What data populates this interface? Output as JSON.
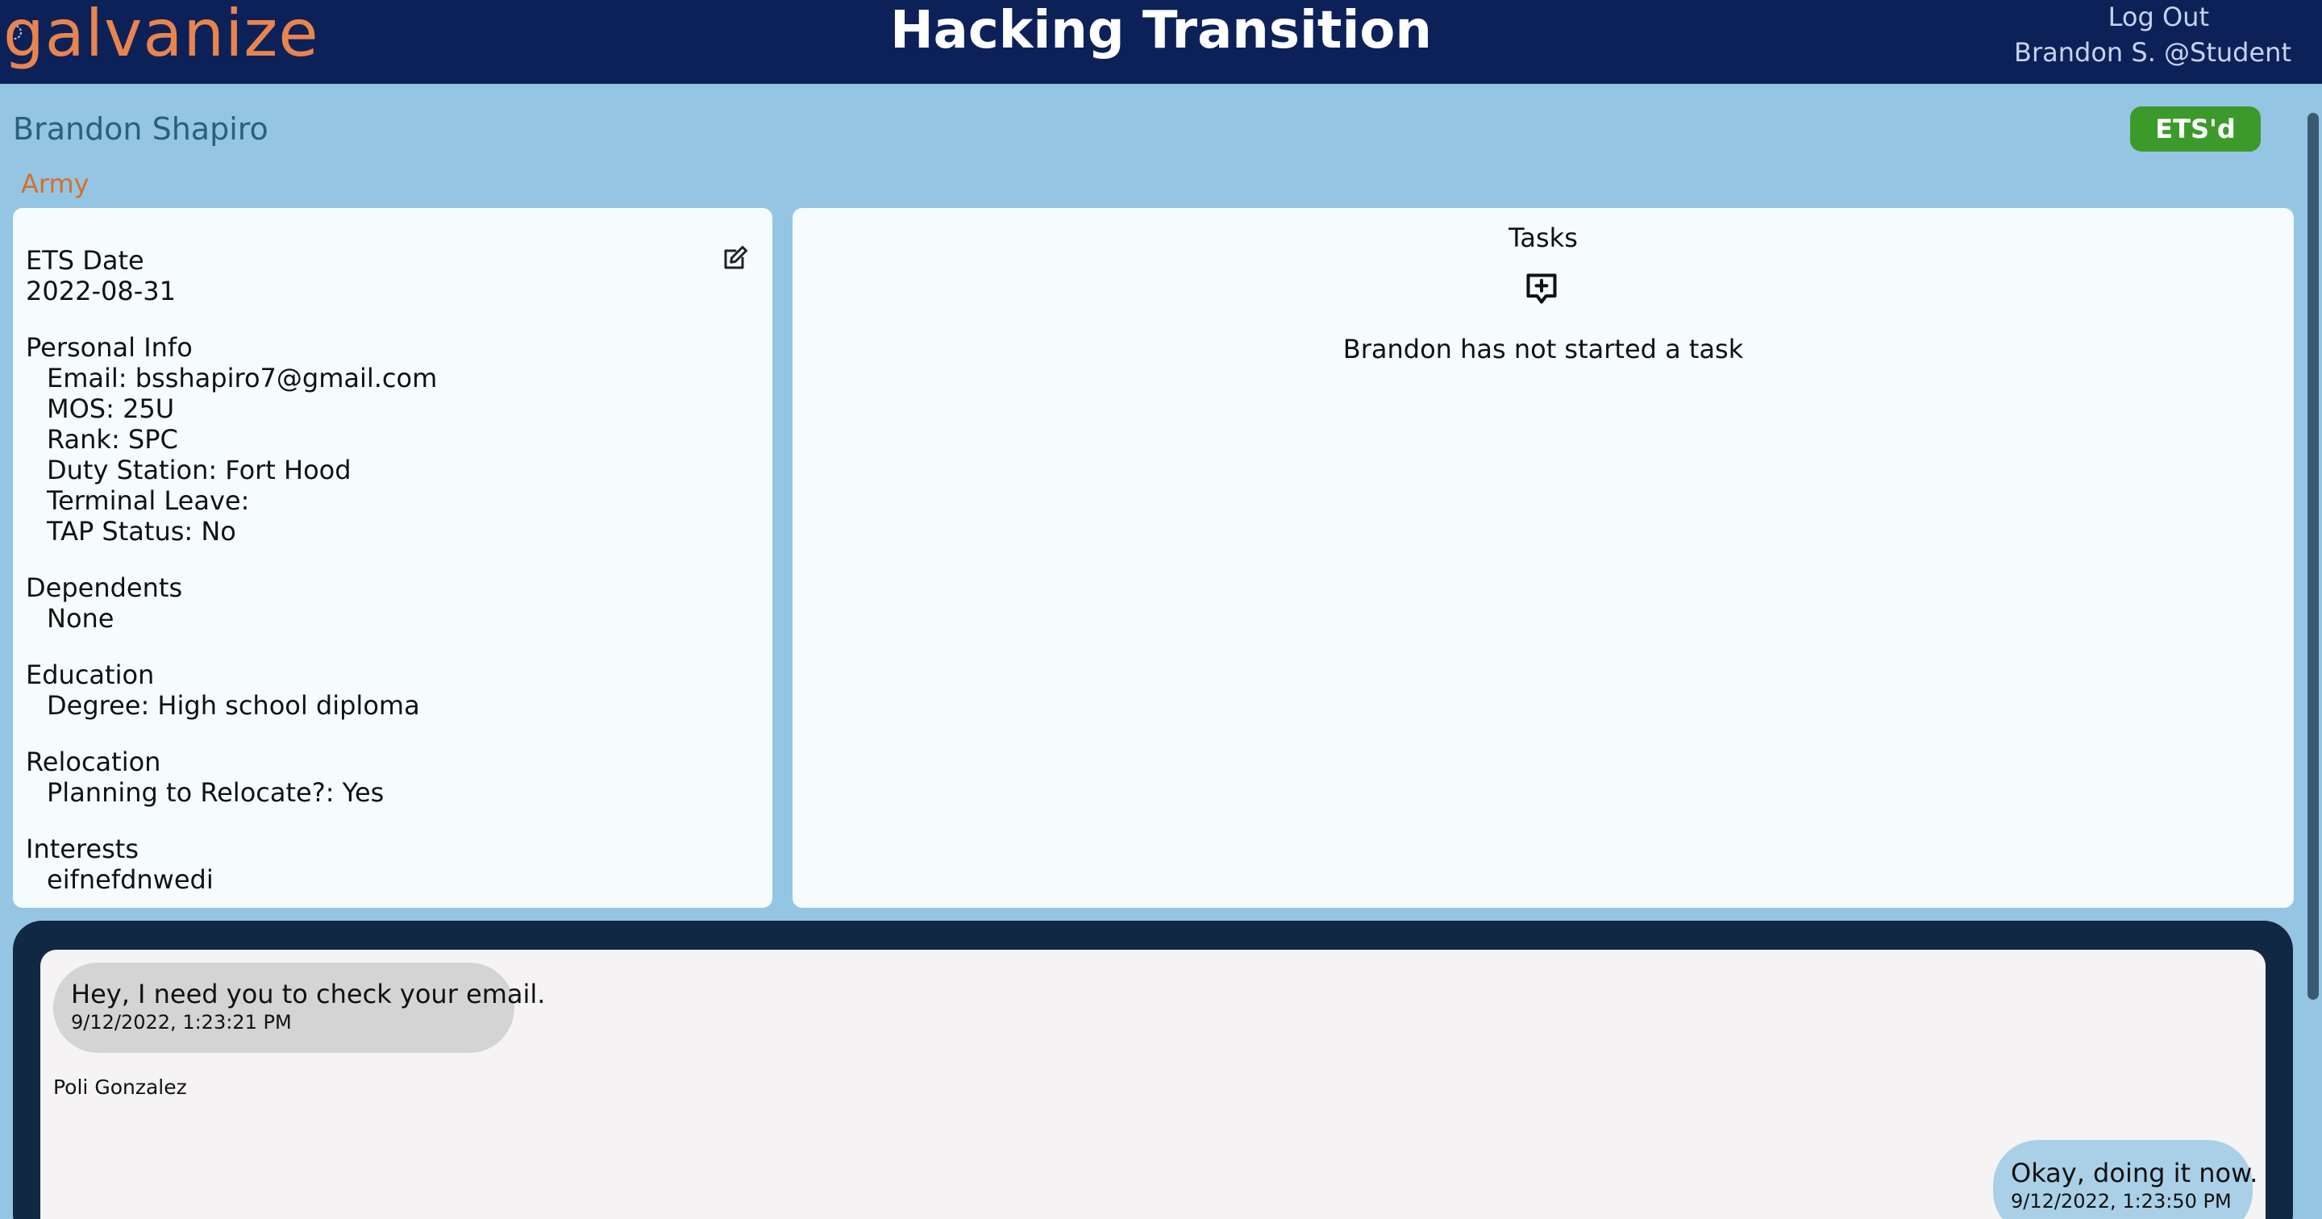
{
  "header": {
    "logo_text": "galvanize",
    "app_title": "Hacking Transition",
    "logout_label": "Log Out",
    "user_handle": "Brandon S. @Student"
  },
  "student": {
    "name": "Brandon Shapiro",
    "branch": "Army",
    "status_badge": "ETS'd"
  },
  "profile": {
    "ets_heading": "ETS Date",
    "ets_date": "2022-08-31",
    "personal_heading": "Personal Info",
    "email": "Email: bsshapiro7@gmail.com",
    "mos": "MOS: 25U",
    "rank": "Rank: SPC",
    "duty_station": "Duty Station: Fort Hood",
    "terminal_leave": "Terminal Leave:",
    "tap_status": "TAP Status: No",
    "dependents_heading": "Dependents",
    "dependents": "None",
    "education_heading": "Education",
    "degree": "Degree: High school diploma",
    "relocation_heading": "Relocation",
    "relocate": "Planning to Relocate?: Yes",
    "interests_heading": "Interests",
    "interests": "eifnefdnwedi"
  },
  "tasks": {
    "title": "Tasks",
    "empty_message": "Brandon has not started a task"
  },
  "chat": {
    "messages": [
      {
        "text": "Hey, I need you to check your email.",
        "time": "9/12/2022, 1:23:21 PM",
        "sender": "Poli Gonzalez"
      },
      {
        "text": "Okay, doing it now.",
        "time": "9/12/2022, 1:23:50 PM"
      }
    ]
  },
  "colors": {
    "header_bg": "#0d2159",
    "page_bg": "#94c6e3",
    "accent_orange": "#e8854e",
    "badge_green": "#3c9a2b",
    "chat_frame": "#112843"
  },
  "icons": {
    "edit": "edit-icon",
    "add_task": "add-task-icon"
  }
}
